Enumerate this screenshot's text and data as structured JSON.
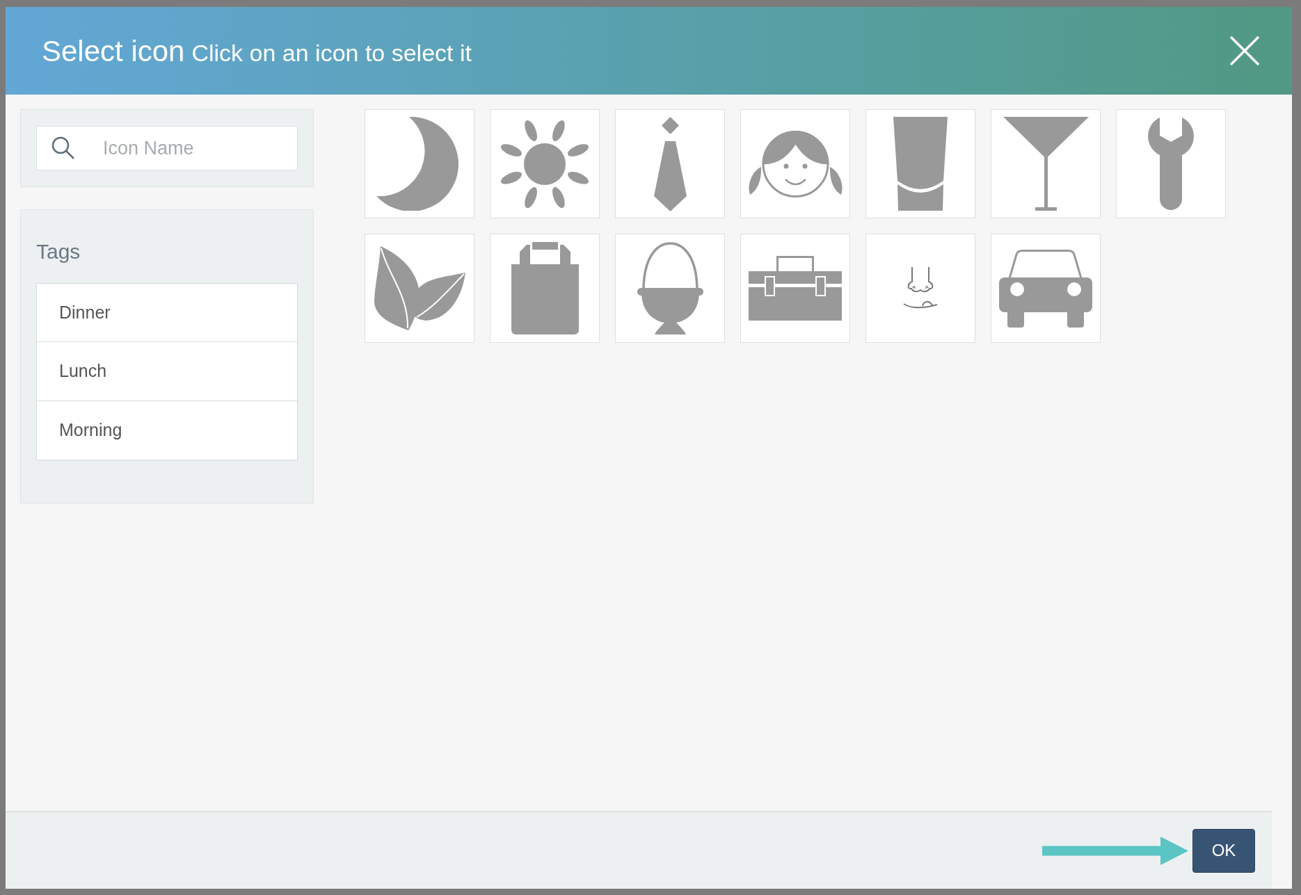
{
  "dialog": {
    "title": "Select icon",
    "subtitle": "Click on an icon to select it"
  },
  "search": {
    "placeholder": "Icon Name"
  },
  "tags": {
    "heading": "Tags",
    "items": [
      "Dinner",
      "Lunch",
      "Morning"
    ]
  },
  "icons": [
    {
      "kind": "moon"
    },
    {
      "kind": "sun"
    },
    {
      "kind": "tie"
    },
    {
      "kind": "girl"
    },
    {
      "kind": "glass"
    },
    {
      "kind": "cocktail"
    },
    {
      "kind": "wrench"
    },
    {
      "kind": "leaves"
    },
    {
      "kind": "bag"
    },
    {
      "kind": "eggcup"
    },
    {
      "kind": "toolbox"
    },
    {
      "kind": "nose"
    },
    {
      "kind": "car"
    }
  ],
  "footer": {
    "buttons": [
      "OK"
    ]
  }
}
